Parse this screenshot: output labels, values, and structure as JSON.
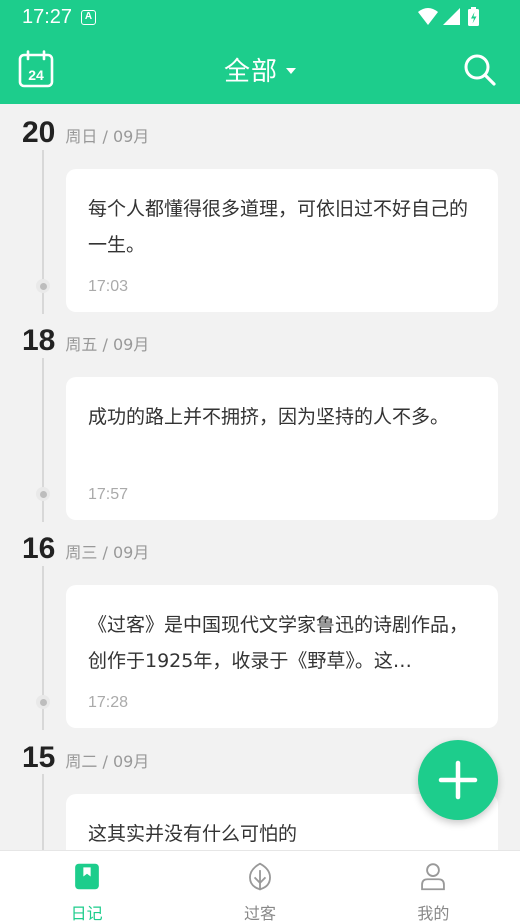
{
  "status_bar": {
    "time": "17:27",
    "notification_badge": "A"
  },
  "app_bar": {
    "title": "全部",
    "calendar_day": "24"
  },
  "entries": [
    {
      "day": "20",
      "meta": "周日 / 09月",
      "text": "每个人都懂得很多道理，可依旧过不好自己的一生。",
      "time": "17:03"
    },
    {
      "day": "18",
      "meta": "周五 / 09月",
      "text": "成功的路上并不拥挤，因为坚持的人不多。",
      "time": "17:57"
    },
    {
      "day": "16",
      "meta": "周三 / 09月",
      "text": "《过客》是中国现代文学家鲁迅的诗剧作品，创作于1925年，收录于《野草》。这…",
      "time": "17:28"
    },
    {
      "day": "15",
      "meta": "周二 / 09月",
      "text": "这其实并没有什么可怕的",
      "time": ""
    }
  ],
  "bottom_nav": {
    "items": [
      {
        "label": "日记",
        "icon": "diary-icon",
        "active": true
      },
      {
        "label": "过客",
        "icon": "leaf-icon",
        "active": false
      },
      {
        "label": "我的",
        "icon": "person-icon",
        "active": false
      }
    ]
  },
  "colors": {
    "accent": "#1dcd8c",
    "background": "#f2f2f2",
    "card": "#ffffff"
  }
}
